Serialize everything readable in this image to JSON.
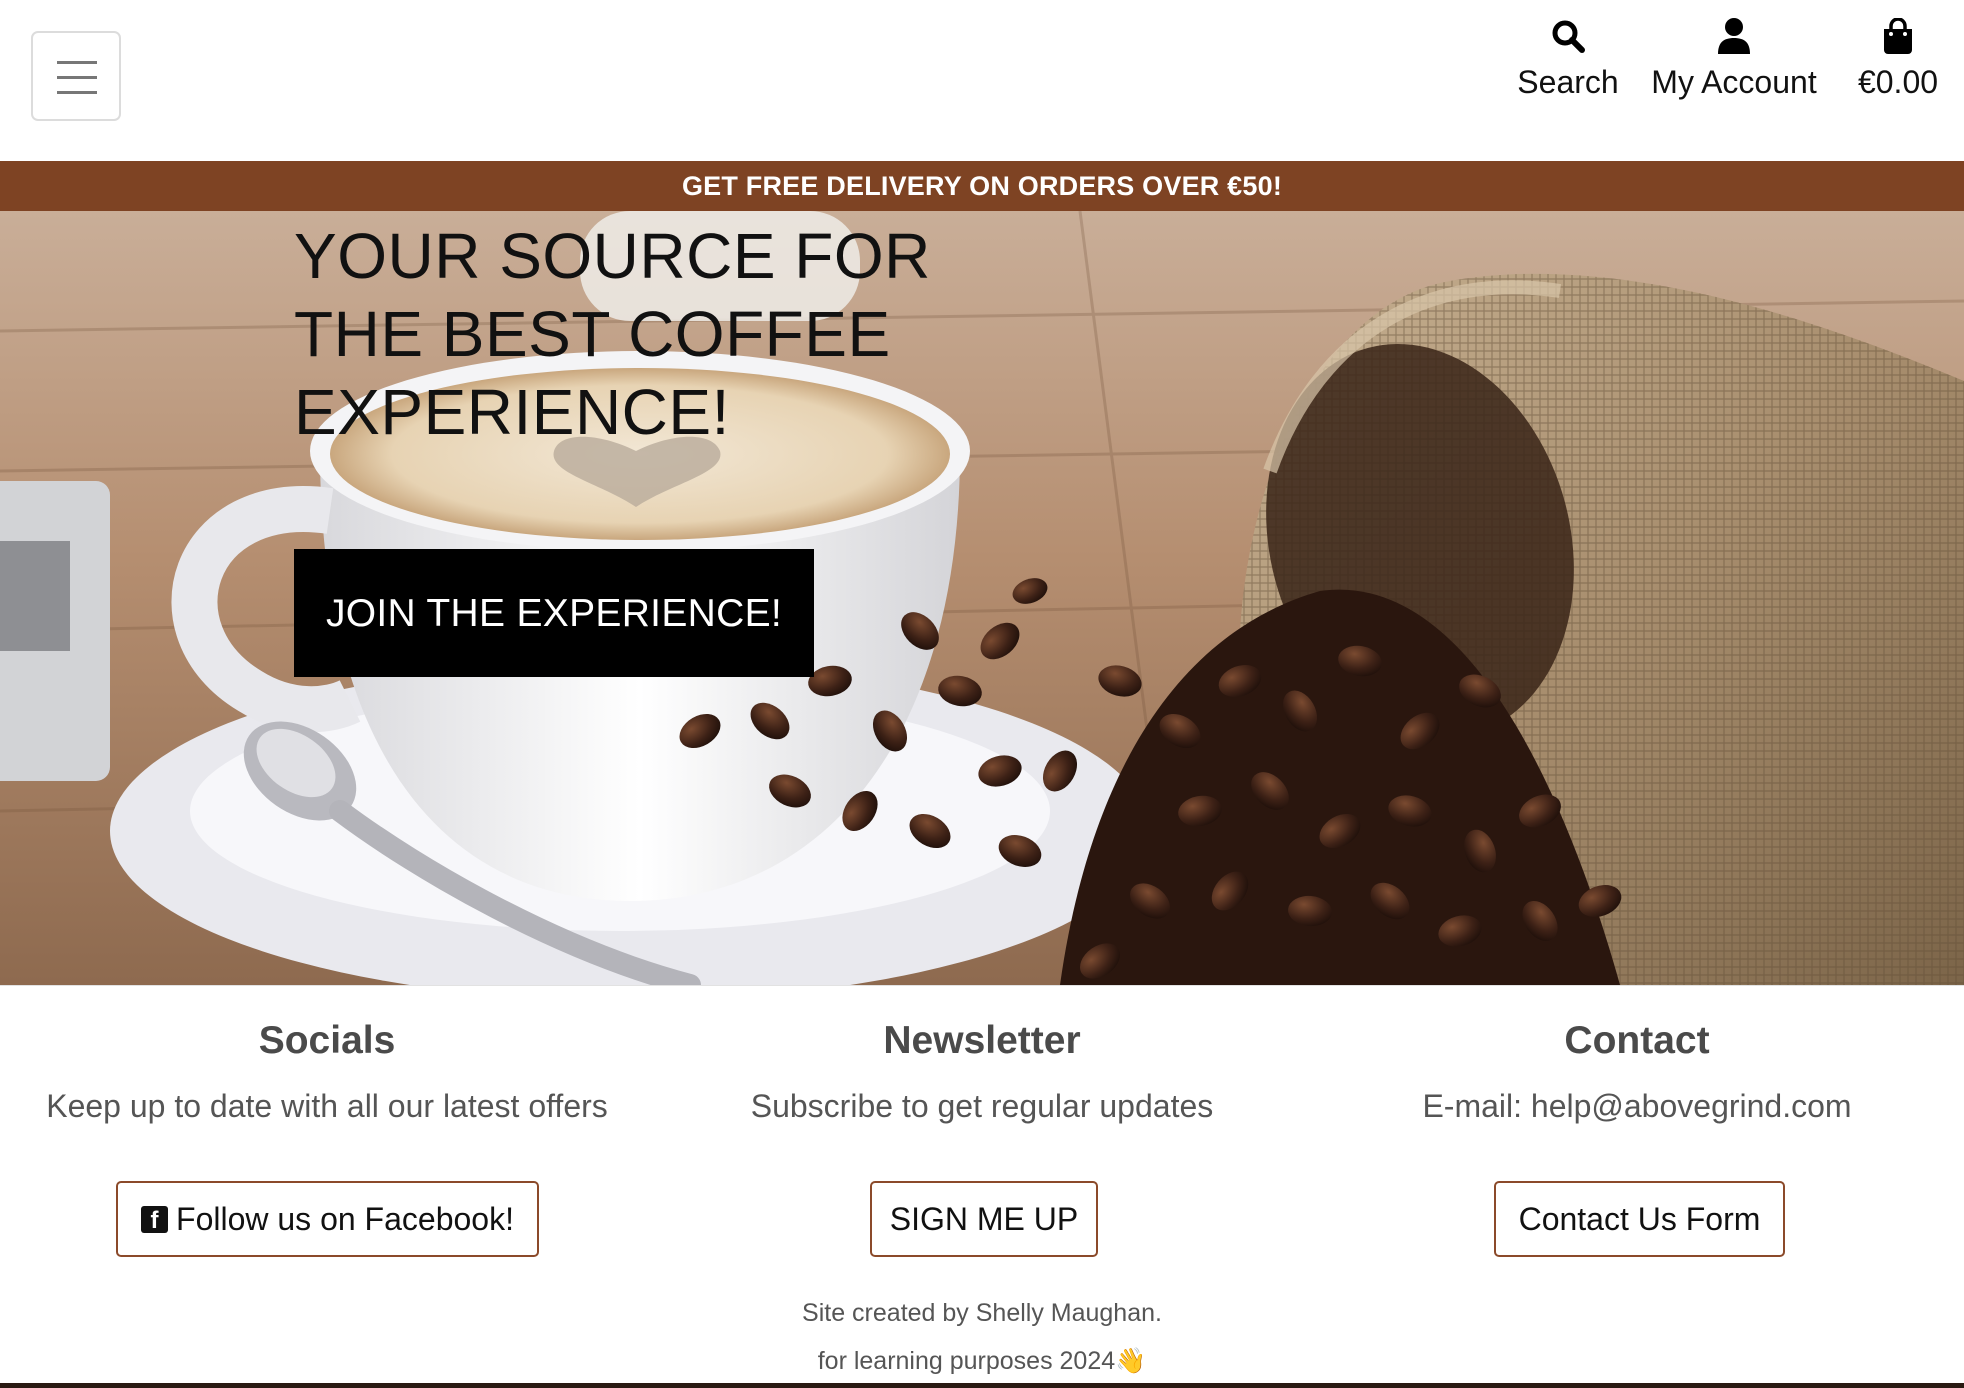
{
  "header": {
    "menu_icon": "hamburger-icon",
    "nav": {
      "search": {
        "icon": "search-icon",
        "label": "Search"
      },
      "account": {
        "icon": "user-icon",
        "label": "My Account"
      },
      "bag": {
        "icon": "shopping-bag-icon",
        "label": "€0.00"
      }
    }
  },
  "banner": {
    "text": "GET FREE DELIVERY ON ORDERS OVER €50!",
    "color": "#7e4323"
  },
  "hero": {
    "title": "YOUR SOURCE FOR THE BEST COFFEE EXPERIENCE!",
    "cta_label": "JOIN THE EXPERIENCE!"
  },
  "footer": {
    "socials": {
      "title": "Socials",
      "text": "Keep up to date with all our latest offers",
      "button": "Follow us on Facebook!",
      "icon": "facebook-icon"
    },
    "newsletter": {
      "title": "Newsletter",
      "text": "Subscribe to get regular updates",
      "button": "SIGN ME UP"
    },
    "contact": {
      "title": "Contact",
      "text": "E-mail: help@abovegrind.com",
      "button": "Contact Us Form"
    },
    "credit_line1": "Site created by Shelly Maughan.",
    "credit_line2": "for learning purposes 2024👋",
    "accent_color": "#8b4a2a"
  }
}
